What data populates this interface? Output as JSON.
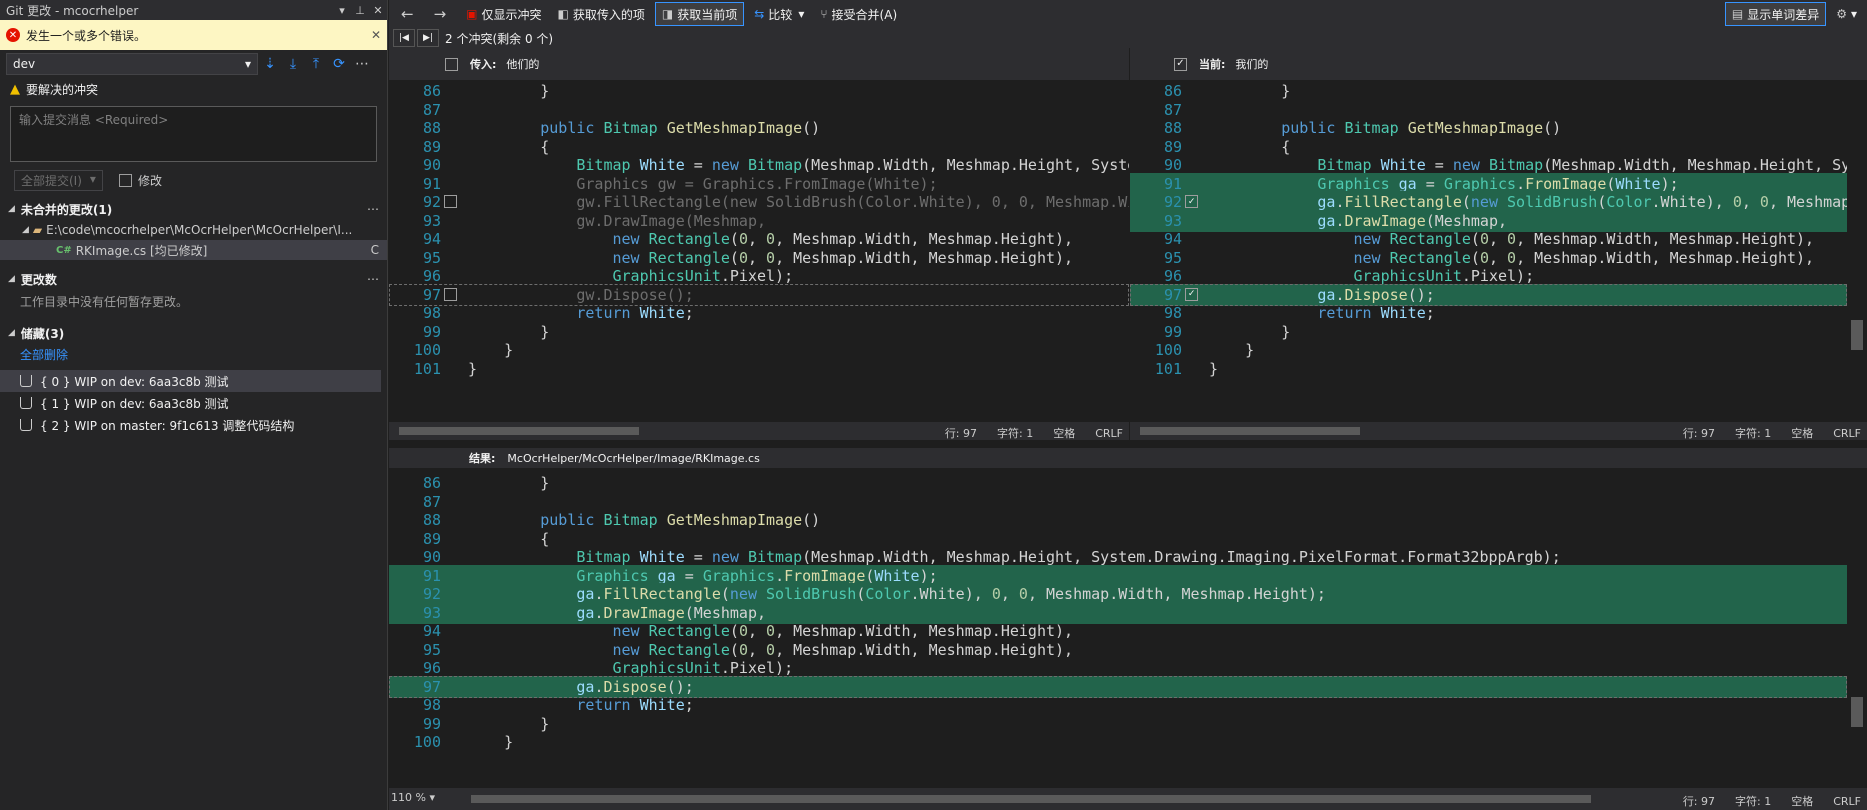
{
  "panel": {
    "title": "Git 更改 - mcocrhelper",
    "error": "发生一个或多个错误。",
    "branch": "dev",
    "conflict_warning": "要解决的冲突",
    "commit_placeholder": "输入提交消息 <Required>",
    "commit_all": "全部提交(I)",
    "amend": "修改",
    "unmerged": {
      "title": "未合并的更改(1)",
      "folder": "E:\\code\\mcocrhelper\\McOcrHelper\\McOcrHelper\\I...",
      "file": "RKImage.cs [均已修改]",
      "file_status": "C"
    },
    "changes": {
      "title": "更改数",
      "empty": "工作目录中没有任何暂存更改。"
    },
    "stashes": {
      "title": "储藏(3)",
      "delete_all": "全部删除",
      "items": [
        "{ 0 } WIP on dev: 6aa3c8b 测试",
        "{ 1 } WIP on dev: 6aa3c8b 测试",
        "{ 2 } WIP on master: 9f1c613 调整代码结构"
      ]
    }
  },
  "toolbar": {
    "only_conflicts": "仅显示冲突",
    "take_incoming": "获取传入的项",
    "take_current": "获取当前项",
    "compare": "比较",
    "accept_merge": "接受合并(A)",
    "show_word_diff": "显示单词差异"
  },
  "conflicts": "2 个冲突(剩余 0 个)",
  "incoming": {
    "label": "传入:",
    "who": "他们的"
  },
  "current": {
    "label": "当前:",
    "who": "我们的"
  },
  "result": {
    "label": "结果:",
    "path": "McOcrHelper/McOcrHelper/Image/RKImage.cs"
  },
  "status": {
    "line": "行: 97",
    "col": "字符: 1",
    "ws": "空格",
    "eol": "CRLF",
    "zoom": "110 %"
  },
  "code": {
    "top_numbers": [
      "86",
      "87",
      "88",
      "89",
      "90",
      "91",
      "92",
      "93",
      "94",
      "95",
      "96",
      "97",
      "98",
      "99",
      "100",
      "101"
    ],
    "bottom_numbers": [
      "86",
      "87",
      "88",
      "89",
      "90",
      "91",
      "92",
      "93",
      "94",
      "95",
      "96",
      "97",
      "98",
      "99",
      "100"
    ]
  },
  "colors": {
    "accent": "#3794ff",
    "conflict_highlight": "#22644b",
    "error": "#e51400"
  }
}
